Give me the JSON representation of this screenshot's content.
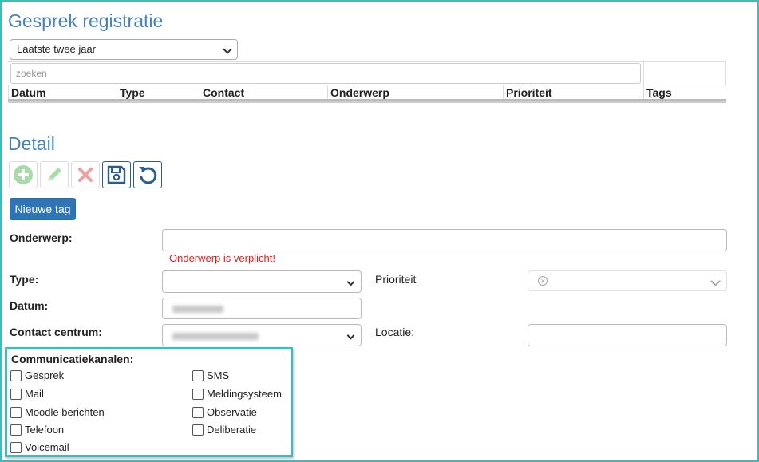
{
  "header": {
    "title": "Gesprek registratie"
  },
  "filter": {
    "period_value": "Laatste twee jaar"
  },
  "search": {
    "placeholder": "zoeken"
  },
  "grid": {
    "columns": [
      "Datum",
      "Type",
      "Contact",
      "Onderwerp",
      "Prioriteit",
      "Tags"
    ]
  },
  "detail": {
    "title": "Detail",
    "toolbar": {
      "add_icon": "plus-circle-icon",
      "edit_icon": "pencil-icon",
      "delete_icon": "x-icon",
      "save_icon": "floppy-disk-icon",
      "undo_icon": "undo-icon"
    },
    "new_tag_label": "Nieuwe tag",
    "fields": {
      "onderwerp_label": "Onderwerp:",
      "onderwerp_error": "Onderwerp is verplicht!",
      "type_label": "Type:",
      "prioriteit_label": "Prioriteit",
      "datum_label": "Datum:",
      "contact_centrum_label": "Contact centrum:",
      "locatie_label": "Locatie:"
    },
    "channels": {
      "title": "Communicatiekanalen:",
      "left": [
        "Gesprek",
        "Mail",
        "Moodle berichten",
        "Telefoon",
        "Voicemail"
      ],
      "right": [
        "SMS",
        "Meldingsysteem",
        "Observatie",
        "Deliberatie"
      ]
    }
  },
  "colors": {
    "accent": "#4a82b8",
    "button": "#2f74b5",
    "error": "#e02020",
    "highlight": "#3dbcbc"
  }
}
